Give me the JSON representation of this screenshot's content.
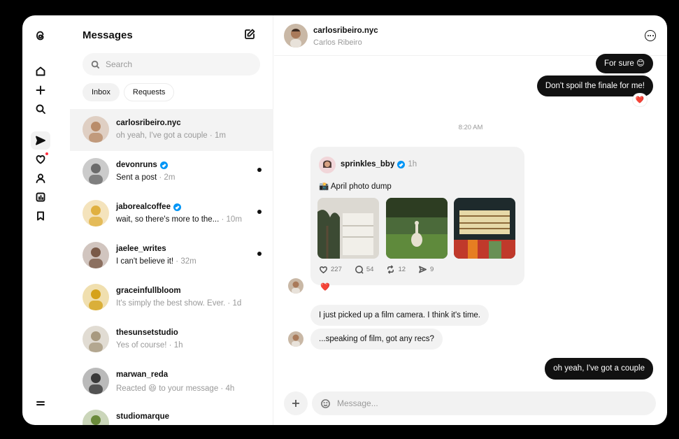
{
  "sidebar": {
    "icons": [
      "threads-logo-icon",
      "home-icon",
      "plus-icon",
      "search-icon",
      "send-icon",
      "heart-icon",
      "profile-icon",
      "insights-icon",
      "bookmark-icon",
      "menu-icon"
    ]
  },
  "list": {
    "title": "Messages",
    "search_placeholder": "Search",
    "tabs": [
      {
        "label": "Inbox"
      },
      {
        "label": "Requests"
      }
    ],
    "conversations": [
      {
        "name": "carlosribeiro.nyc",
        "preview": "oh yeah, I've got a couple",
        "time": "1m",
        "verified": false,
        "unread": false,
        "selected": true,
        "avatar_color": "#b98c6a"
      },
      {
        "name": "devonruns",
        "preview": "Sent a post",
        "time": "2m",
        "verified": true,
        "unread": true,
        "selected": false,
        "avatar_color": "#6b6b6b"
      },
      {
        "name": "jaborealcoffee",
        "preview": "wait, so there's more to the...",
        "time": "10m",
        "verified": true,
        "unread": true,
        "selected": false,
        "avatar_color": "#e0b040"
      },
      {
        "name": "jaelee_writes",
        "preview": "I can't believe it!",
        "time": "32m",
        "verified": false,
        "unread": true,
        "selected": false,
        "avatar_color": "#7a5a48"
      },
      {
        "name": "graceinfullbloom",
        "preview": "It's simply the best show. Ever.",
        "time": "1d",
        "verified": false,
        "unread": false,
        "selected": false,
        "avatar_color": "#d5a21b"
      },
      {
        "name": "thesunsetstudio",
        "preview": "Yes of course!",
        "time": "1h",
        "verified": false,
        "unread": false,
        "selected": false,
        "avatar_color": "#a89a80"
      },
      {
        "name": "marwan_reda",
        "preview": "Reacted 😆 to your message",
        "time": "4h",
        "verified": false,
        "unread": false,
        "selected": false,
        "avatar_color": "#3a3a3a"
      },
      {
        "name": "studiomarque",
        "preview": "",
        "time": "",
        "verified": false,
        "unread": false,
        "selected": false,
        "avatar_color": "#6a8a3a"
      }
    ]
  },
  "chat": {
    "username": "carlosribeiro.nyc",
    "full_name": "Carlos Ribeiro",
    "messages": {
      "m1": "For sure 😊",
      "m2": "Don't spoil the finale for me!",
      "reaction_heart": "❤️",
      "timestamp": "8:20 AM",
      "m3": "I just picked up a film camera. I think it's time.",
      "m4": "...speaking of film, got any recs?",
      "m5": "oh yeah, I've got a couple"
    },
    "post": {
      "author": "sprinkles_bby",
      "time": "1h",
      "text": "📸 April photo dump",
      "likes": "227",
      "comments": "54",
      "reposts": "12",
      "shares": "9"
    },
    "composer_placeholder": "Message..."
  }
}
